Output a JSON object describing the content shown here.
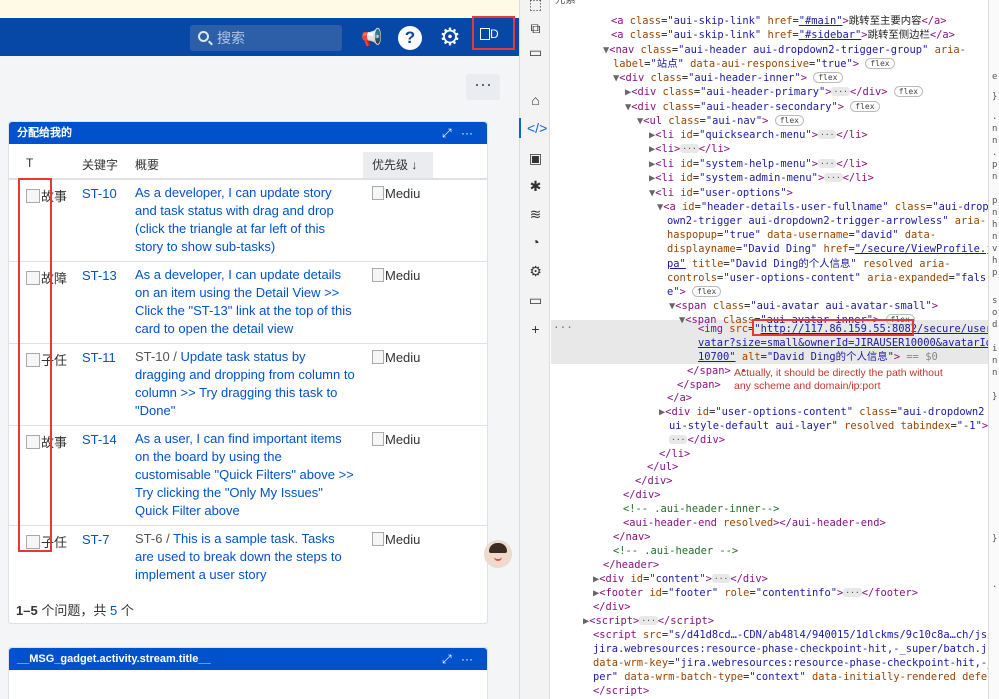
{
  "jira": {
    "search_placeholder": "搜索",
    "avatar_alt": "D",
    "more_button": "···",
    "panel_title": "分配给我的",
    "panel_controls": "⤢ ···",
    "columns": {
      "type": "T",
      "key": "关键字",
      "summary": "概要",
      "priority": "优先级 ↓"
    },
    "rows": [
      {
        "type": "故事",
        "key": "ST-10",
        "parent": "",
        "summary": "As a developer, I can update story and task status with drag and drop (click the triangle at far left of this story to show sub-tasks)",
        "priority": "Mediu"
      },
      {
        "type": "故障",
        "key": "ST-13",
        "parent": "",
        "summary": "As a developer, I can update details on an item using the Detail View >> Click the \"ST-13\" link at the top of this card to open the detail view",
        "priority": "Mediu"
      },
      {
        "type": "子任",
        "key": "ST-11",
        "parent": "ST-10 /",
        "summary": "Update task status by dragging and dropping from column to column >> Try dragging this task to \"Done\"",
        "priority": "Mediu"
      },
      {
        "type": "故事",
        "key": "ST-14",
        "parent": "",
        "summary": "As a user, I can find important items on the board by using the customisable \"Quick Filters\" above >> Try clicking the \"Only My Issues\" Quick Filter above",
        "priority": "Mediu"
      },
      {
        "type": "子任",
        "key": "ST-7",
        "parent": "ST-6 /",
        "summary": "This is a sample task. Tasks are used to break down the steps to implement a user story",
        "priority": "Mediu"
      }
    ],
    "footer": {
      "range": "1–5",
      "text1": " 个问题，共 ",
      "total": "5",
      "text2": " 个"
    },
    "panel2_title": "__MSG_gadget.activity.stream.title__"
  },
  "devtools": {
    "tab_label": "元素",
    "annotation": "Actually, it should be directly the path without any scheme and domain/ip:port"
  }
}
